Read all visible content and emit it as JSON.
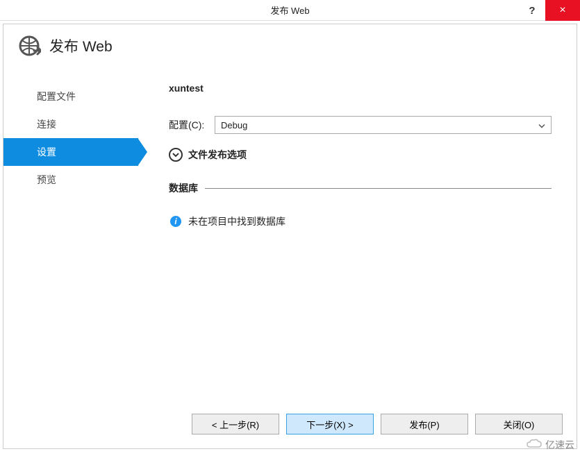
{
  "titlebar": {
    "title": "发布 Web",
    "help": "?",
    "close": "×"
  },
  "header": {
    "title": "发布 Web"
  },
  "sidebar": {
    "items": [
      {
        "label": "配置文件"
      },
      {
        "label": "连接"
      },
      {
        "label": "设置"
      },
      {
        "label": "预览"
      }
    ]
  },
  "content": {
    "project_name": "xuntest",
    "config_label": "配置(C):",
    "config_value": "Debug",
    "expander_label": "文件发布选项",
    "database_section": "数据库",
    "db_notice": "未在项目中找到数据库"
  },
  "footer": {
    "prev": "< 上一步(R)",
    "next": "下一步(X) >",
    "publish": "发布(P)",
    "close": "关闭(O)"
  },
  "watermark": "亿速云"
}
